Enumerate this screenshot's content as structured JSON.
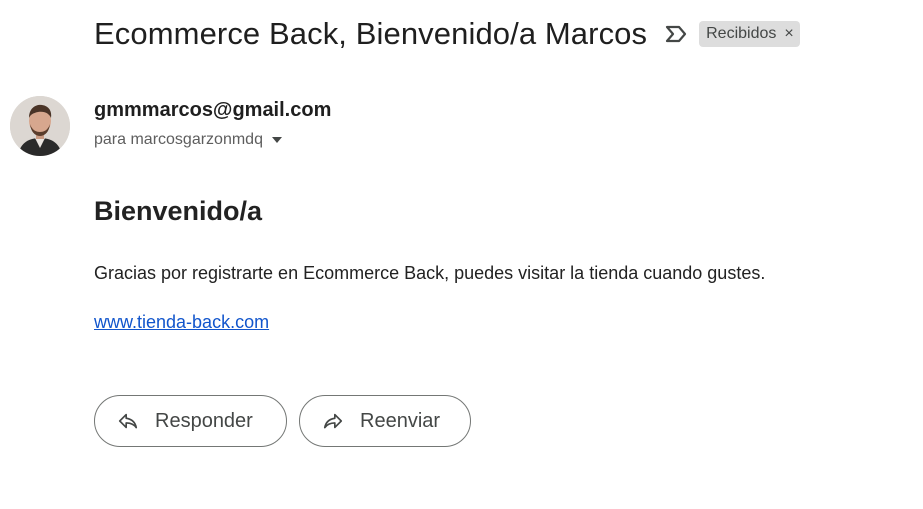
{
  "email": {
    "subject": "Ecommerce Back, Bienvenido/a Marcos",
    "label": "Recibidos",
    "label_close": "×",
    "sender": "gmmmarcos@gmail.com",
    "recipient_line": "para marcosgarzonmdq",
    "body": {
      "heading": "Bienvenido/a",
      "paragraph": "Gracias por registrarte en Ecommerce Back, puedes visitar la tienda cuando gustes.",
      "link": "www.tienda-back.com"
    }
  },
  "actions": {
    "reply_label": "Responder",
    "forward_label": "Reenviar"
  },
  "icons": {
    "important": "important-marker-icon",
    "reply": "reply-icon",
    "forward": "forward-icon",
    "caret": "chevron-down-icon"
  },
  "colors": {
    "link": "#1155cc",
    "chip_bg": "#dddddd",
    "text": "#1f1f1f"
  }
}
